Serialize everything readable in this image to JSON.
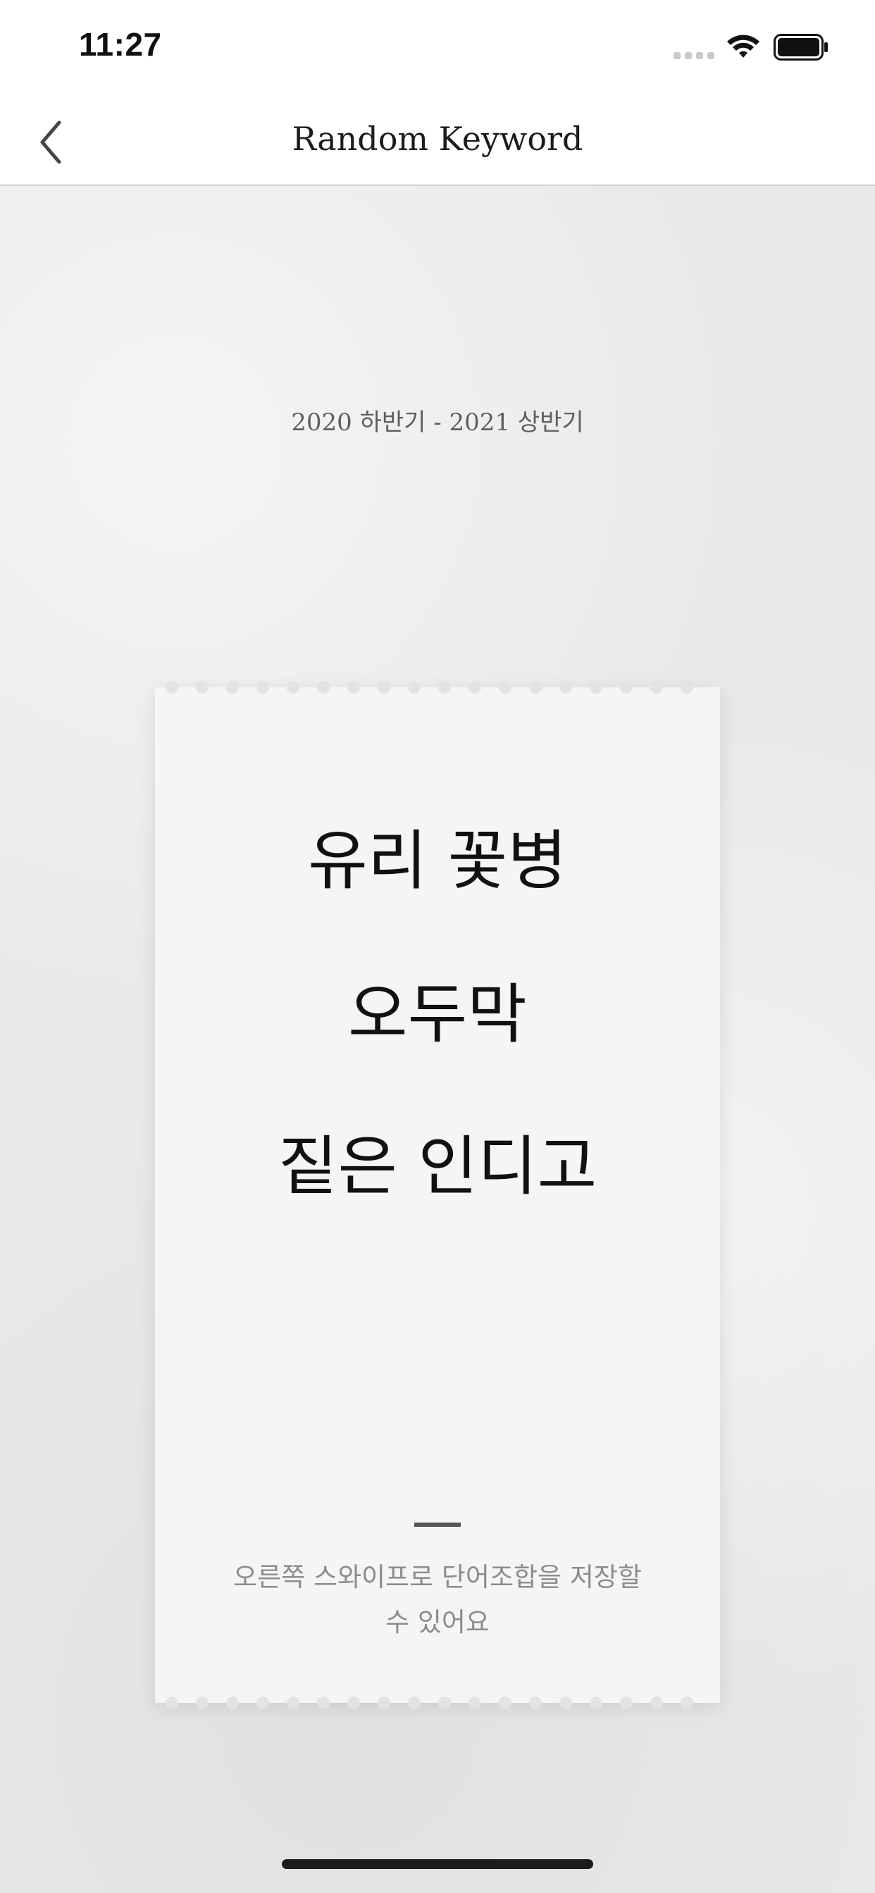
{
  "status_bar": {
    "time": "11:27"
  },
  "nav": {
    "title": "Random Keyword",
    "back_icon": "chevron-left-icon"
  },
  "main": {
    "period": "2020 하반기 - 2021 상반기",
    "keywords": [
      "유리 꽃병",
      "오두막",
      "짙은 인디고"
    ],
    "hint": "오른쪽 스와이프로 단어조합을 저장할 수 있어요"
  },
  "colors": {
    "background": "#eae9e8",
    "ticket": "#f5f5f4",
    "text": "#111111",
    "muted": "#8c8c8c"
  }
}
